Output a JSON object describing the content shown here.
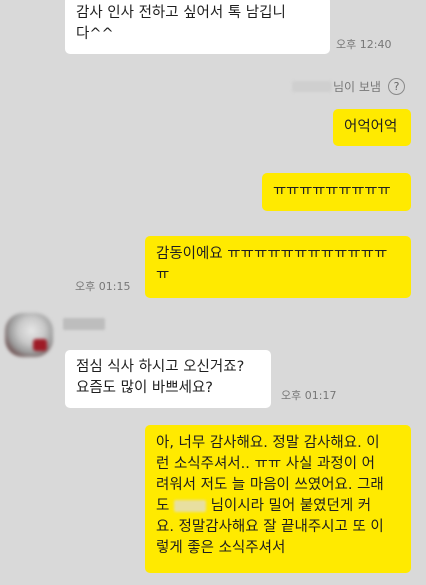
{
  "messages": {
    "m1": {
      "lines": [
        "감사 인사 전하고 싶어서 톡 남깁니",
        "다^^"
      ],
      "time": "오후 12:40"
    },
    "sender_label": "님이 보냄",
    "help_icon": "?",
    "m2": "어억어억",
    "m3": "ㅠㅠㅠㅠㅠㅠㅠㅠㅠ",
    "m4": {
      "lines": [
        "감동이에요 ㅠㅠㅠㅠㅠㅠㅠㅠㅠㅠㅠㅠ",
        "ㅠ"
      ],
      "time": "오후 01:15"
    },
    "m5": {
      "lines": [
        "점심 식사 하시고 오신거죠?",
        "요즘도 많이 바쁘세요?"
      ],
      "time": "오후 01:17"
    },
    "m6": {
      "lines": [
        "아, 너무 감사해요. 정말 감사해요. 이",
        "런 소식주셔서.. ㅠㅠ 사실 과정이 어",
        "려워서 저도 늘 마음이 쓰였어요. 그래",
        "님이시라 밀어 붙였던게 커",
        "요. 정말감사해요 잘 끝내주시고 또 이",
        "렇게 좋은 소식주셔서"
      ],
      "line4_prefix": "도"
    }
  }
}
